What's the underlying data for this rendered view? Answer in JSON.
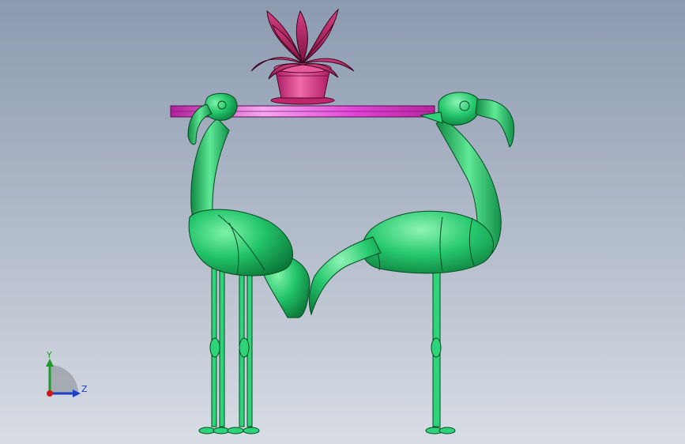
{
  "viewport": {
    "background_top": "#8c9ab0",
    "background_bottom": "#d8dde5"
  },
  "model": {
    "table_top_color": "#e040d8",
    "flamingo_color": "#22c46a",
    "pot_color": "#d62f86",
    "plant_color": "#b01d5a"
  },
  "triad": {
    "y_label": "Y",
    "z_label": "Z",
    "y_color": "#1f9a2a",
    "z_color": "#1d3fc4",
    "x_color": "#d01818"
  }
}
